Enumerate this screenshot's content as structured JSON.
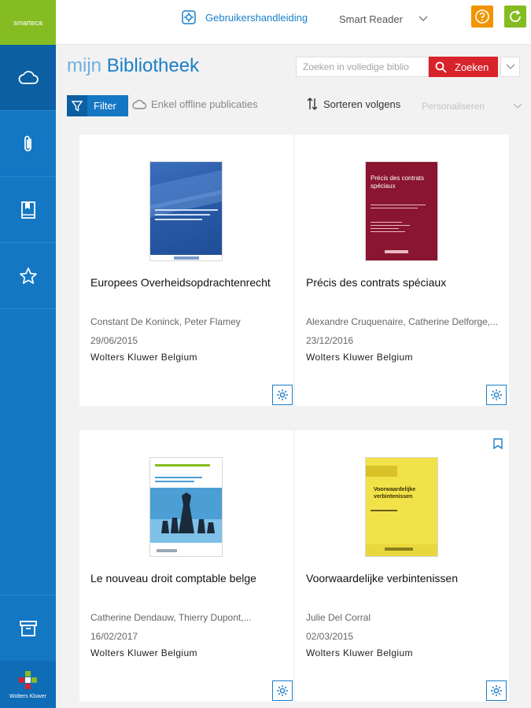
{
  "brand": "smarteca",
  "topbar": {
    "manual_label": "Gebruikershandleiding",
    "reader_label": "Smart Reader"
  },
  "header": {
    "title_prefix": "mijn",
    "title_main": "Bibliotheek",
    "search_placeholder": "Zoeken in volledige biblio",
    "search_button": "Zoeken"
  },
  "toolbar": {
    "filter": "Filter",
    "offline": "Enkel offline publicaties",
    "sort": "Sorteren volgens",
    "personalize": "Personaliseren"
  },
  "sidebar": {
    "items": [
      "cloud-icon",
      "paperclip-icon",
      "book-icon",
      "star-icon"
    ],
    "archive": "archive-icon",
    "footer": "Wolters Kluwer"
  },
  "books": [
    {
      "title": "Europees Overheidsopdrachtenrecht",
      "authors": "Constant De Koninck, Peter Flamey",
      "date": "29/06/2015",
      "publisher": "Wolters Kluwer Belgium",
      "cover_color": "#2a5aa8"
    },
    {
      "title": "Précis des contrats spéciaux",
      "authors": "Alexandre Cruquenaire, Catherine Delforge,...",
      "date": "23/12/2016",
      "publisher": "Wolters Kluwer Belgium",
      "cover_color": "#8a1530",
      "cover_title": "Précis des contrats spéciaux"
    },
    {
      "title": "Le nouveau droit comptable belge",
      "authors": "Catherine Dendauw, Thierry Dupont,...",
      "date": "16/02/2017",
      "publisher": "Wolters Kluwer Belgium",
      "cover_color": "#4b9fd4"
    },
    {
      "title": "Voorwaardelijke verbintenissen",
      "authors": "Julie Del Corral",
      "date": "02/03/2015",
      "publisher": "Wolters Kluwer Belgium",
      "cover_color": "#f2e24a",
      "cover_title": "Voorwaardelijke verbintenissen"
    }
  ]
}
